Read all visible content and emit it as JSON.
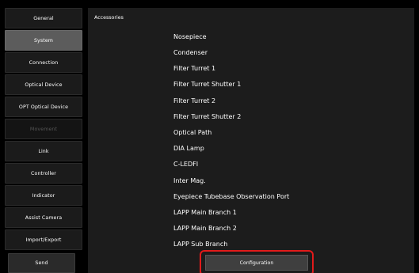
{
  "nav": {
    "items": [
      {
        "label": "General"
      },
      {
        "label": "System"
      },
      {
        "label": "Connection"
      },
      {
        "label": "Optical Device"
      },
      {
        "label": "OPT Optical Device"
      },
      {
        "label": "Movement"
      },
      {
        "label": "Link"
      },
      {
        "label": "Controller"
      },
      {
        "label": "Indicator"
      },
      {
        "label": "Assist Camera"
      },
      {
        "label": "Import/Export"
      },
      {
        "label": "Send"
      }
    ],
    "active": "System",
    "disabled": "Movement"
  },
  "panel": {
    "title": "Accessories",
    "items": [
      "Nosepiece",
      "Condenser",
      "Filter Turret 1",
      "Filter Turret Shutter 1",
      "Filter Turret 2",
      "Filter Turret Shutter 2",
      "Optical Path",
      "DIA Lamp",
      "C-LEDFI",
      "Inter Mag.",
      "Eyepiece Tubebase Observation Port",
      "LAPP Main Branch 1",
      "LAPP Main Branch 2",
      "LAPP Sub Branch"
    ],
    "configuration_label": "Configuration"
  },
  "colors": {
    "highlight_outline": "#e21a1a",
    "active_nav": "#5c5c5c",
    "panel_bg": "#1c1c1c"
  }
}
